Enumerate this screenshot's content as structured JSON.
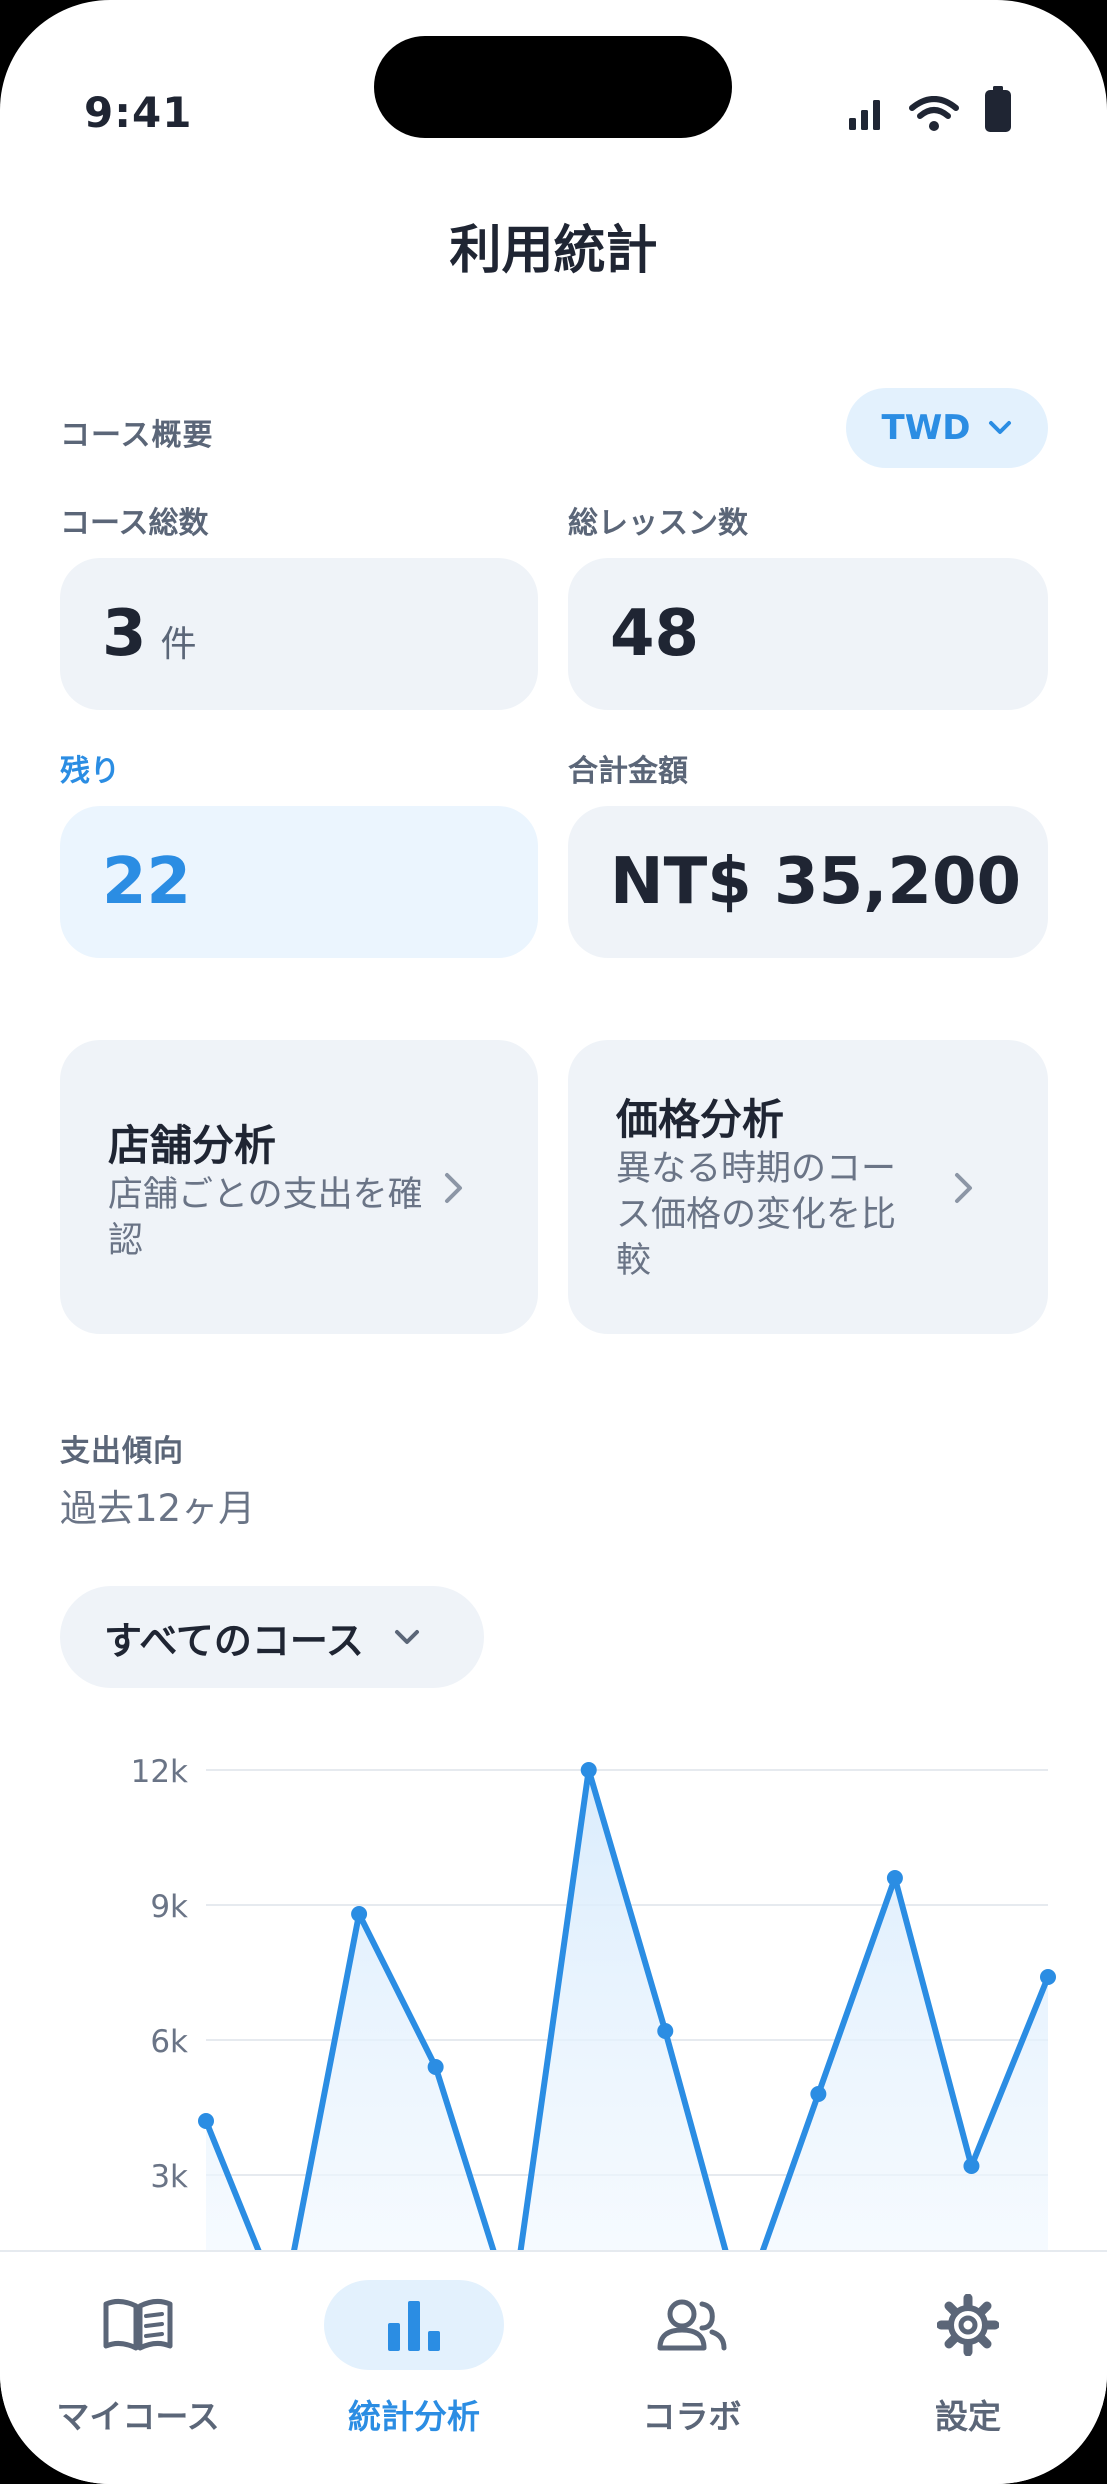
{
  "status_bar": {
    "time": "9:41"
  },
  "page_title": "利用統計",
  "overview": {
    "section_label": "コース概要",
    "currency": "TWD",
    "stats": {
      "course_total_label": "コース総数",
      "course_total_value": "3",
      "course_total_unit": "件",
      "lessons_total_label": "総レッスン数",
      "lessons_total_value": "48",
      "remaining_label": "残り",
      "remaining_value": "22",
      "amount_total_label": "合計金額",
      "amount_total_value": "NT$ 35,200"
    }
  },
  "analysis_cards": [
    {
      "title": "店舗分析",
      "description": "店舗ごとの支出を確認"
    },
    {
      "title": "価格分析",
      "description": "異なる時期のコース価格の変化を比較"
    }
  ],
  "trend": {
    "section_label": "支出傾向",
    "subtitle": "過去12ヶ月",
    "filter_label": "すべてのコース"
  },
  "chart_data": {
    "type": "area",
    "title": "",
    "xlabel": "",
    "ylabel": "",
    "ylim": [
      0,
      12000
    ],
    "y_ticks": [
      3000,
      6000,
      9000,
      12000
    ],
    "y_tick_labels": [
      "3k",
      "6k",
      "9k",
      "12k"
    ],
    "grid": true,
    "series": [
      {
        "values": [
          4200,
          0,
          8800,
          5400,
          0,
          12000,
          6200,
          0,
          4800,
          9600,
          3200,
          7400
        ]
      }
    ],
    "colors": {
      "line": "#2b8de3",
      "fill": "#e3f1fd",
      "grid": "#e6eaef"
    }
  },
  "tab_bar": {
    "tabs": [
      {
        "label": "マイコース",
        "icon": "book-icon",
        "active": false
      },
      {
        "label": "統計分析",
        "icon": "bar-chart-icon",
        "active": true
      },
      {
        "label": "コラボ",
        "icon": "users-icon",
        "active": false
      },
      {
        "label": "設定",
        "icon": "gear-icon",
        "active": false
      }
    ]
  },
  "colors": {
    "accent": "#2b8de3",
    "text": "#1f2533",
    "muted": "#5b6678",
    "card": "#eff3f8"
  }
}
